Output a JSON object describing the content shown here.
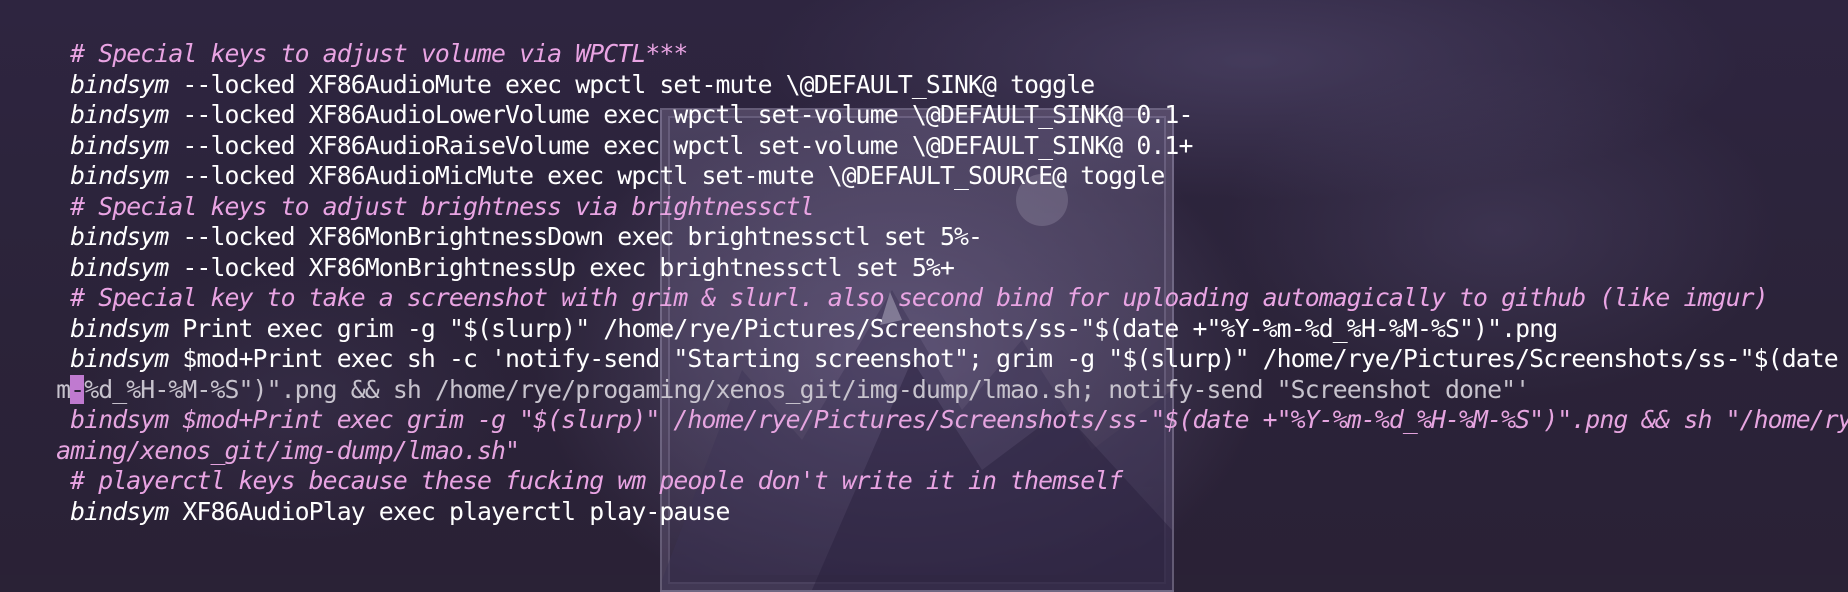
{
  "colors": {
    "background": "#2a2236",
    "comment": "#e9a4e3",
    "text": "#ffffff",
    "cursor": "#c07ad0"
  },
  "terminal": {
    "lines": [
      {
        "type": "comment",
        "text": " # Special keys to adjust volume via WPCTL***"
      },
      {
        "type": "code",
        "kw": " bindsym",
        "rest": " --locked XF86AudioMute exec wpctl set-mute \\@DEFAULT_SINK@ toggle"
      },
      {
        "type": "code",
        "kw": " bindsym",
        "rest": " --locked XF86AudioLowerVolume exec wpctl set-volume \\@DEFAULT_SINK@ 0.1-"
      },
      {
        "type": "code",
        "kw": " bindsym",
        "rest": " --locked XF86AudioRaiseVolume exec wpctl set-volume \\@DEFAULT_SINK@ 0.1+"
      },
      {
        "type": "code",
        "kw": " bindsym",
        "rest": " --locked XF86AudioMicMute exec wpctl set-mute \\@DEFAULT_SOURCE@ toggle"
      },
      {
        "type": "comment",
        "text": " # Special keys to adjust brightness via brightnessctl"
      },
      {
        "type": "code",
        "kw": " bindsym",
        "rest": " --locked XF86MonBrightnessDown exec brightnessctl set 5%-"
      },
      {
        "type": "code",
        "kw": " bindsym",
        "rest": " --locked XF86MonBrightnessUp exec brightnessctl set 5%+"
      },
      {
        "type": "comment",
        "text": " # Special key to take a screenshot with grim & slurl. also second bind for uploading automagically to github (like imgur)"
      },
      {
        "type": "code",
        "kw": " bindsym",
        "rest": " Print exec grim -g \"$(slurp)\" /home/rye/Pictures/Screenshots/ss-\"$(date +\"%Y-%m-%d_%H-%M-%S\")\".png"
      },
      {
        "type": "code",
        "kw": " bindsym",
        "rest": " $mod+Print exec sh -c 'notify-send \"Starting screenshot\"; grim -g \"$(slurp)\" /home/rye/Pictures/Screenshots/ss-\"$(date +\"%"
      },
      {
        "type": "cursorline",
        "pre": "m",
        "cursor": "-",
        "rest": "%d_%H-%M-%S\")\".png && sh /home/rye/progaming/xenos_git/img-dump/lmao.sh; notify-send \"Screenshot done\"'"
      },
      {
        "type": "string",
        "kw": " bindsym",
        "rest": " $mod+Print exec grim -g \"$(slurp)\" /home/rye/Pictures/Screenshots/ss-\"$(date +\"%Y-%m-%d_%H-%M-%S\")\".png && sh \"/home/rye/p"
      },
      {
        "type": "stringcont",
        "text": "aming/xenos_git/img-dump/lmao.sh\""
      },
      {
        "type": "comment",
        "text": " # playerctl keys because these fucking wm people don't write it in themself"
      },
      {
        "type": "code",
        "kw": " bindsym",
        "rest": " XF86AudioPlay exec playerctl play-pause"
      }
    ]
  }
}
